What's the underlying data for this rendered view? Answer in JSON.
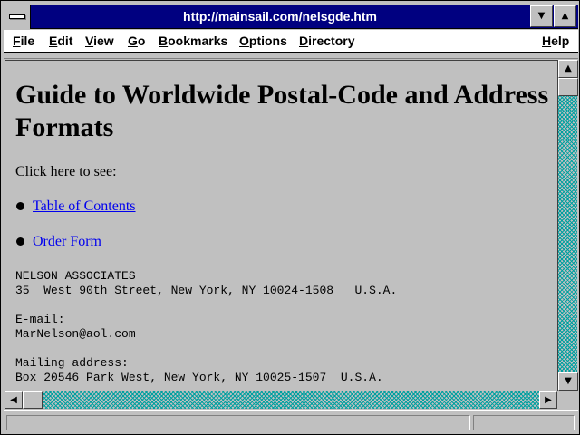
{
  "window": {
    "title": "http://mainsail.com/nelsgde.htm",
    "minimize_glyph": "▼",
    "maximize_glyph": "▲"
  },
  "menu": {
    "file": {
      "u": "F",
      "rest": "ile"
    },
    "edit": {
      "u": "E",
      "rest": "dit"
    },
    "view": {
      "u": "V",
      "rest": "iew"
    },
    "go": {
      "u": "G",
      "rest": "o"
    },
    "bookmarks": {
      "u": "B",
      "rest": "ookmarks"
    },
    "options": {
      "u": "O",
      "rest": "ptions"
    },
    "directory": {
      "u": "D",
      "rest": "irectory"
    },
    "help": {
      "u": "H",
      "rest": "elp"
    }
  },
  "page": {
    "heading": "Guide to Worldwide Postal-Code and Address Formats",
    "intro": "Click here to see:",
    "links": [
      "Table of Contents",
      "Order Form"
    ],
    "contact_block": "NELSON ASSOCIATES\n35  West 90th Street, New York, NY 10024-1508   U.S.A.\n\nE-mail:\nMarNelson@aol.com\n\nMailing address:\nBox 20546 Park West, New York, NY 10025-1507  U.S.A."
  },
  "scrollbars": {
    "up_glyph": "▲",
    "down_glyph": "▼",
    "left_glyph": "◀",
    "right_glyph": "▶"
  },
  "status": {
    "text": ""
  }
}
